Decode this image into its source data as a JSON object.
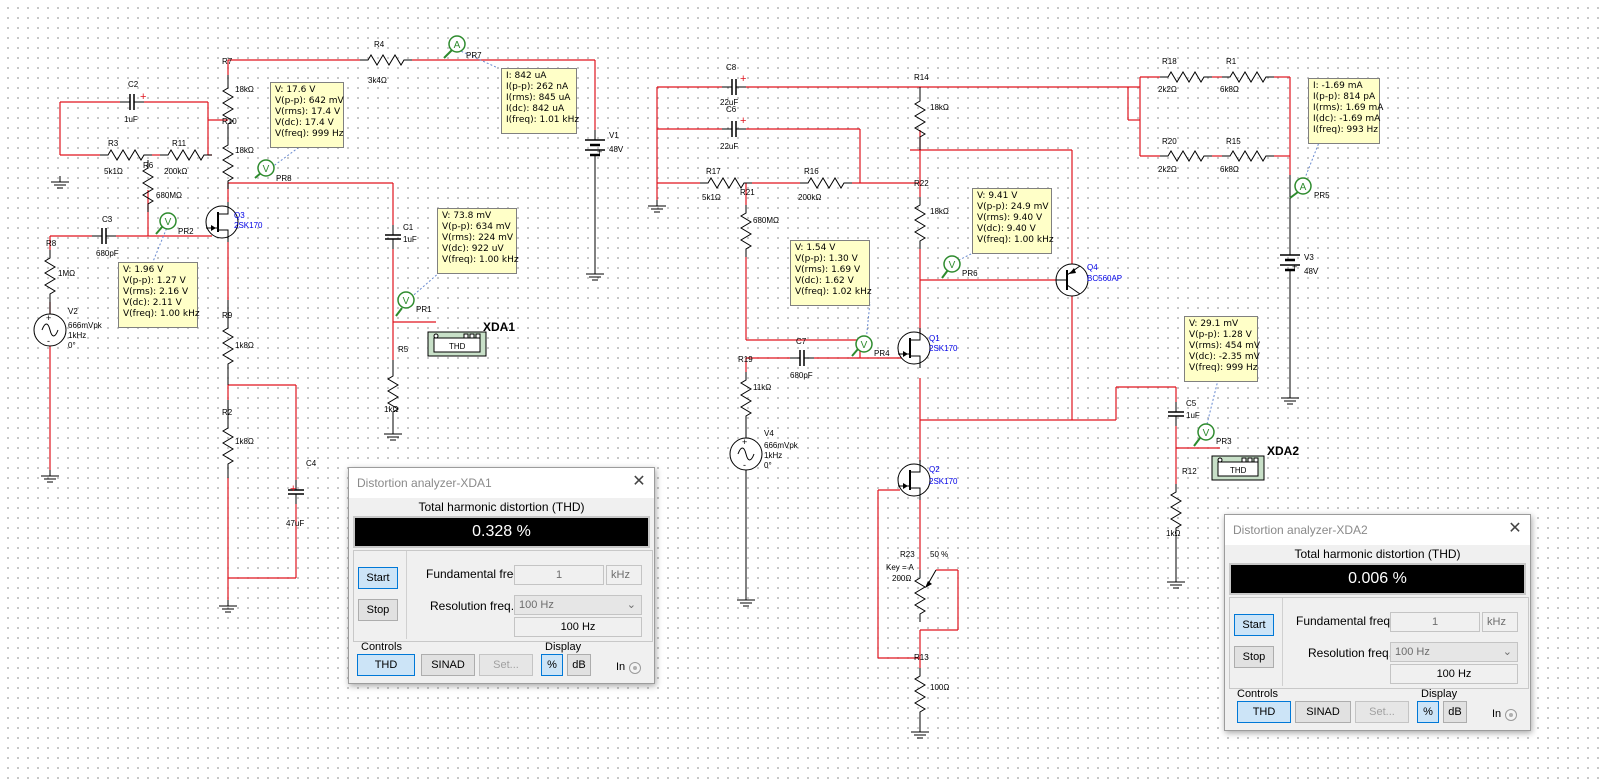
{
  "components": {
    "R1": {
      "ref": "R1",
      "value": "6k8Ω"
    },
    "R2": {
      "ref": "R2",
      "value": "1k8Ω"
    },
    "R3": {
      "ref": "R3",
      "value": "5k1Ω"
    },
    "R4": {
      "ref": "R4",
      "value": "3k4Ω"
    },
    "R5": {
      "ref": "R5",
      "value": "1kΩ"
    },
    "R6": {
      "ref": "R6",
      "value": "680MΩ"
    },
    "R7": {
      "ref": "R7",
      "value": "18kΩ"
    },
    "R8": {
      "ref": "R8",
      "value": "1MΩ"
    },
    "R9": {
      "ref": "R9",
      "value": "1k8Ω"
    },
    "R10": {
      "ref": "R10",
      "value": "18kΩ"
    },
    "R11": {
      "ref": "R11",
      "value": "200kΩ"
    },
    "R12": {
      "ref": "R12",
      "value": "1kΩ"
    },
    "R13": {
      "ref": "R13",
      "value": "100Ω"
    },
    "R14": {
      "ref": "R14",
      "value": "18kΩ"
    },
    "R15": {
      "ref": "R15",
      "value": "6k8Ω"
    },
    "R16": {
      "ref": "R16",
      "value": "200kΩ"
    },
    "R17": {
      "ref": "R17",
      "value": "5k1Ω"
    },
    "R18": {
      "ref": "R18",
      "value": "2k2Ω"
    },
    "R19": {
      "ref": "R19",
      "value": "11kΩ"
    },
    "R20": {
      "ref": "R20",
      "value": "2k2Ω"
    },
    "R21": {
      "ref": "R21",
      "value": "680MΩ"
    },
    "R22": {
      "ref": "R22",
      "value": "18kΩ"
    },
    "R23": {
      "ref": "R23",
      "value": "200Ω",
      "key": "Key = A",
      "pct": "50 %"
    },
    "C1": {
      "ref": "C1",
      "value": "1uF"
    },
    "C2": {
      "ref": "C2",
      "value": "1uF"
    },
    "C3": {
      "ref": "C3",
      "value": "680pF"
    },
    "C4": {
      "ref": "C4",
      "value": "47uF"
    },
    "C5": {
      "ref": "C5",
      "value": "1uF"
    },
    "C6": {
      "ref": "C6",
      "value": "22uF"
    },
    "C7": {
      "ref": "C7",
      "value": "680pF"
    },
    "C8": {
      "ref": "C8",
      "value": "22uF"
    },
    "V1": {
      "ref": "V1",
      "value": "48V"
    },
    "V2": {
      "ref": "V2",
      "l1": "666mVpk",
      "l2": "1kHz",
      "l3": "0°"
    },
    "V3": {
      "ref": "V3",
      "value": "48V"
    },
    "V4": {
      "ref": "V4",
      "l1": "666mVpk",
      "l2": "1kHz",
      "l3": "0°"
    },
    "Q1": {
      "ref": "Q1",
      "part": "2SK170"
    },
    "Q2": {
      "ref": "Q2",
      "part": "2SK170"
    },
    "Q3": {
      "ref": "Q3",
      "part": "2SK170"
    },
    "Q4": {
      "ref": "Q4",
      "part": "BC560AP"
    },
    "XDA1": {
      "ref": "XDA1",
      "badge": "THD"
    },
    "XDA2": {
      "ref": "XDA2",
      "badge": "THD"
    },
    "probes": {
      "PR1": "PR1",
      "PR2": "PR2",
      "PR3": "PR3",
      "PR4": "PR4",
      "PR5": "PR5",
      "PR6": "PR6",
      "PR7": "PR7",
      "PR8": "PR8"
    },
    "probe_v": "V",
    "probe_a": "A"
  },
  "probe_notes": {
    "pr8": [
      "V: 17.6 V",
      "V(p-p): 642 mV",
      "V(rms): 17.4 V",
      "V(dc): 17.4 V",
      "V(freq): 999 Hz"
    ],
    "pr7": [
      "I: 842 uA",
      "I(p-p): 262 nA",
      "I(rms): 845 uA",
      "I(dc): 842 uA",
      "I(freq): 1.01 kHz"
    ],
    "pr1": [
      "V: 73.8 mV",
      "V(p-p): 634 mV",
      "V(rms): 224 mV",
      "V(dc): 922 uV",
      "V(freq): 1.00 kHz"
    ],
    "pr2": [
      "V: 1.96 V",
      "V(p-p): 1.27 V",
      "V(rms): 2.16 V",
      "V(dc): 2.11 V",
      "V(freq): 1.00 kHz"
    ],
    "pr6": [
      "V: 9.41 V",
      "V(p-p): 24.9 mV",
      "V(rms): 9.40 V",
      "V(dc): 9.40 V",
      "V(freq): 1.00 kHz"
    ],
    "pr4": [
      "V: 1.54 V",
      "V(p-p): 1.30 V",
      "V(rms): 1.69 V",
      "V(dc): 1.62 V",
      "V(freq): 1.02 kHz"
    ],
    "pr5": [
      "I: -1.69 mA",
      "I(p-p): 814 pA",
      "I(rms): 1.69 mA",
      "I(dc): -1.69 mA",
      "I(freq): 993 Hz"
    ],
    "pr3": [
      "V: 29.1 mV",
      "V(p-p): 1.28 V",
      "V(rms): 454 mV",
      "V(dc): -2.35 mV",
      "V(freq): 999 Hz"
    ]
  },
  "analyzer_1": {
    "title": "Distortion analyzer-XDA1",
    "thd_label": "Total harmonic distortion (THD)",
    "thd_value": "0.328 %",
    "start": "Start",
    "stop": "Stop",
    "fund_label": "Fundamental freq.",
    "fund_value": "1",
    "fund_unit": "kHz",
    "res_label": "Resolution freq.",
    "res_select": "100 Hz",
    "res_value": "100 Hz",
    "controls_label": "Controls",
    "thd_btn": "THD",
    "sinad_btn": "SINAD",
    "set_btn": "Set...",
    "display_label": "Display",
    "pct_btn": "%",
    "db_btn": "dB",
    "in_label": "In",
    "close": "✕"
  },
  "analyzer_2": {
    "title": "Distortion analyzer-XDA2",
    "thd_label": "Total harmonic distortion (THD)",
    "thd_value": "0.006 %",
    "start": "Start",
    "stop": "Stop",
    "fund_label": "Fundamental freq.",
    "fund_value": "1",
    "fund_unit": "kHz",
    "res_label": "Resolution freq.",
    "res_select": "100 Hz",
    "res_value": "100 Hz",
    "controls_label": "Controls",
    "thd_btn": "THD",
    "sinad_btn": "SINAD",
    "set_btn": "Set...",
    "display_label": "Display",
    "pct_btn": "%",
    "db_btn": "dB",
    "in_label": "In",
    "close": "✕"
  },
  "colors": {
    "wire": "#e0141e",
    "ground": "#000000",
    "probe": "#2e8b2e",
    "part_blue": "#0000e6",
    "note_bg": "#ffffc8"
  }
}
